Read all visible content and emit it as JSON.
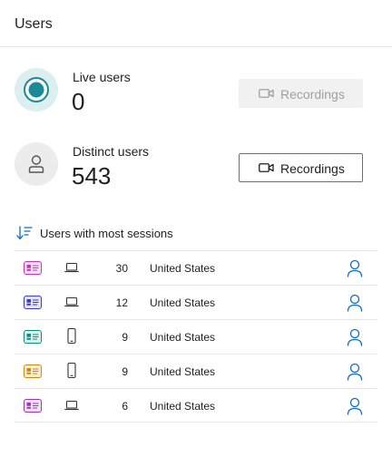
{
  "header": {
    "title": "Users"
  },
  "live": {
    "label": "Live users",
    "value": "0",
    "button_label": "Recordings",
    "button_enabled": false
  },
  "distinct": {
    "label": "Distinct users",
    "value": "543",
    "button_label": "Recordings",
    "button_enabled": true
  },
  "list": {
    "title": "Users with most sessions",
    "rows": [
      {
        "badge_color": "#c239b3",
        "badge_bg": "#f5e1f3",
        "device": "laptop-icon",
        "sessions": "30",
        "country": "United States"
      },
      {
        "badge_color": "#3c3cb4",
        "badge_bg": "#e3e3f7",
        "device": "laptop-icon",
        "sessions": "12",
        "country": "United States"
      },
      {
        "badge_color": "#0e8c80",
        "badge_bg": "#dcf1ee",
        "device": "phone-icon",
        "sessions": "9",
        "country": "United States"
      },
      {
        "badge_color": "#c58a16",
        "badge_bg": "#fbedd2",
        "device": "phone-icon",
        "sessions": "9",
        "country": "United States"
      },
      {
        "badge_color": "#9a38b2",
        "badge_bg": "#f1e1f5",
        "device": "laptop-icon",
        "sessions": "6",
        "country": "United States"
      }
    ]
  },
  "colors": {
    "accent_teal": "#1b8a94",
    "profile_blue": "#0f6cbd"
  }
}
